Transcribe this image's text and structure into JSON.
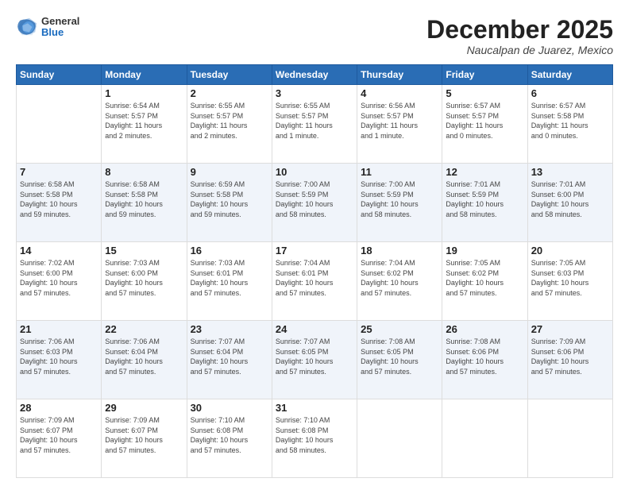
{
  "header": {
    "logo_general": "General",
    "logo_blue": "Blue",
    "month_title": "December 2025",
    "location": "Naucalpan de Juarez, Mexico"
  },
  "weekdays": [
    "Sunday",
    "Monday",
    "Tuesday",
    "Wednesday",
    "Thursday",
    "Friday",
    "Saturday"
  ],
  "weeks": [
    [
      {
        "day": "",
        "info": ""
      },
      {
        "day": "1",
        "info": "Sunrise: 6:54 AM\nSunset: 5:57 PM\nDaylight: 11 hours\nand 2 minutes."
      },
      {
        "day": "2",
        "info": "Sunrise: 6:55 AM\nSunset: 5:57 PM\nDaylight: 11 hours\nand 2 minutes."
      },
      {
        "day": "3",
        "info": "Sunrise: 6:55 AM\nSunset: 5:57 PM\nDaylight: 11 hours\nand 1 minute."
      },
      {
        "day": "4",
        "info": "Sunrise: 6:56 AM\nSunset: 5:57 PM\nDaylight: 11 hours\nand 1 minute."
      },
      {
        "day": "5",
        "info": "Sunrise: 6:57 AM\nSunset: 5:57 PM\nDaylight: 11 hours\nand 0 minutes."
      },
      {
        "day": "6",
        "info": "Sunrise: 6:57 AM\nSunset: 5:58 PM\nDaylight: 11 hours\nand 0 minutes."
      }
    ],
    [
      {
        "day": "7",
        "info": "Sunrise: 6:58 AM\nSunset: 5:58 PM\nDaylight: 10 hours\nand 59 minutes."
      },
      {
        "day": "8",
        "info": "Sunrise: 6:58 AM\nSunset: 5:58 PM\nDaylight: 10 hours\nand 59 minutes."
      },
      {
        "day": "9",
        "info": "Sunrise: 6:59 AM\nSunset: 5:58 PM\nDaylight: 10 hours\nand 59 minutes."
      },
      {
        "day": "10",
        "info": "Sunrise: 7:00 AM\nSunset: 5:59 PM\nDaylight: 10 hours\nand 58 minutes."
      },
      {
        "day": "11",
        "info": "Sunrise: 7:00 AM\nSunset: 5:59 PM\nDaylight: 10 hours\nand 58 minutes."
      },
      {
        "day": "12",
        "info": "Sunrise: 7:01 AM\nSunset: 5:59 PM\nDaylight: 10 hours\nand 58 minutes."
      },
      {
        "day": "13",
        "info": "Sunrise: 7:01 AM\nSunset: 6:00 PM\nDaylight: 10 hours\nand 58 minutes."
      }
    ],
    [
      {
        "day": "14",
        "info": "Sunrise: 7:02 AM\nSunset: 6:00 PM\nDaylight: 10 hours\nand 57 minutes."
      },
      {
        "day": "15",
        "info": "Sunrise: 7:03 AM\nSunset: 6:00 PM\nDaylight: 10 hours\nand 57 minutes."
      },
      {
        "day": "16",
        "info": "Sunrise: 7:03 AM\nSunset: 6:01 PM\nDaylight: 10 hours\nand 57 minutes."
      },
      {
        "day": "17",
        "info": "Sunrise: 7:04 AM\nSunset: 6:01 PM\nDaylight: 10 hours\nand 57 minutes."
      },
      {
        "day": "18",
        "info": "Sunrise: 7:04 AM\nSunset: 6:02 PM\nDaylight: 10 hours\nand 57 minutes."
      },
      {
        "day": "19",
        "info": "Sunrise: 7:05 AM\nSunset: 6:02 PM\nDaylight: 10 hours\nand 57 minutes."
      },
      {
        "day": "20",
        "info": "Sunrise: 7:05 AM\nSunset: 6:03 PM\nDaylight: 10 hours\nand 57 minutes."
      }
    ],
    [
      {
        "day": "21",
        "info": "Sunrise: 7:06 AM\nSunset: 6:03 PM\nDaylight: 10 hours\nand 57 minutes."
      },
      {
        "day": "22",
        "info": "Sunrise: 7:06 AM\nSunset: 6:04 PM\nDaylight: 10 hours\nand 57 minutes."
      },
      {
        "day": "23",
        "info": "Sunrise: 7:07 AM\nSunset: 6:04 PM\nDaylight: 10 hours\nand 57 minutes."
      },
      {
        "day": "24",
        "info": "Sunrise: 7:07 AM\nSunset: 6:05 PM\nDaylight: 10 hours\nand 57 minutes."
      },
      {
        "day": "25",
        "info": "Sunrise: 7:08 AM\nSunset: 6:05 PM\nDaylight: 10 hours\nand 57 minutes."
      },
      {
        "day": "26",
        "info": "Sunrise: 7:08 AM\nSunset: 6:06 PM\nDaylight: 10 hours\nand 57 minutes."
      },
      {
        "day": "27",
        "info": "Sunrise: 7:09 AM\nSunset: 6:06 PM\nDaylight: 10 hours\nand 57 minutes."
      }
    ],
    [
      {
        "day": "28",
        "info": "Sunrise: 7:09 AM\nSunset: 6:07 PM\nDaylight: 10 hours\nand 57 minutes."
      },
      {
        "day": "29",
        "info": "Sunrise: 7:09 AM\nSunset: 6:07 PM\nDaylight: 10 hours\nand 57 minutes."
      },
      {
        "day": "30",
        "info": "Sunrise: 7:10 AM\nSunset: 6:08 PM\nDaylight: 10 hours\nand 57 minutes."
      },
      {
        "day": "31",
        "info": "Sunrise: 7:10 AM\nSunset: 6:08 PM\nDaylight: 10 hours\nand 58 minutes."
      },
      {
        "day": "",
        "info": ""
      },
      {
        "day": "",
        "info": ""
      },
      {
        "day": "",
        "info": ""
      }
    ]
  ]
}
